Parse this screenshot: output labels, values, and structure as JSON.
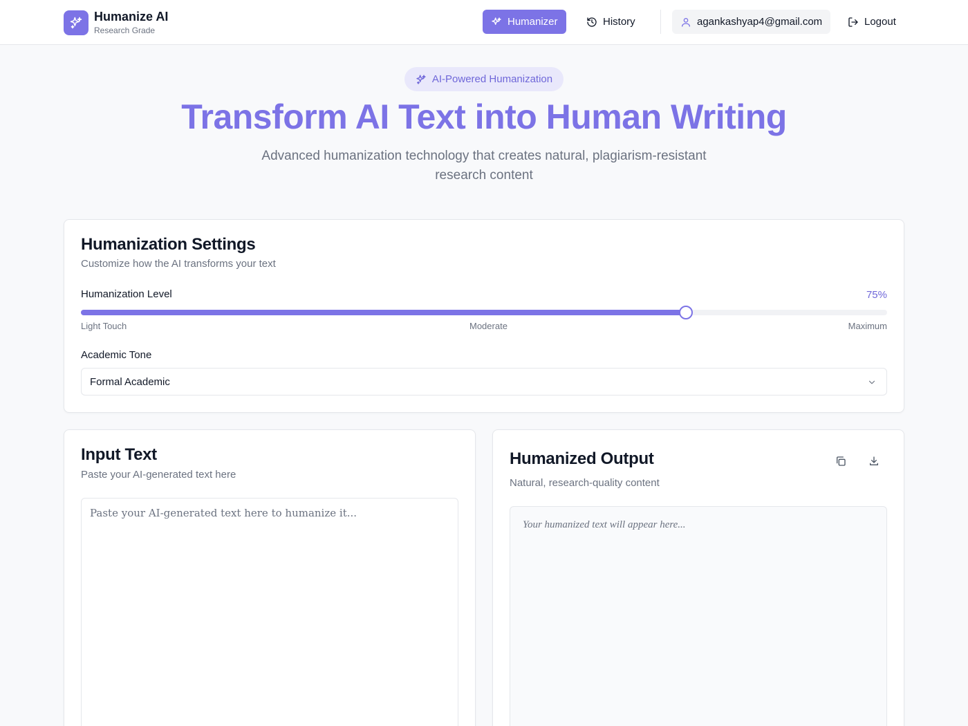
{
  "brand": {
    "name": "Humanize AI",
    "subtitle": "Research Grade",
    "icon": "sparkles-icon"
  },
  "nav": {
    "humanizer": "Humanizer",
    "history": "History",
    "user_email": "agankashyap4@gmail.com",
    "logout": "Logout"
  },
  "hero": {
    "badge": "AI-Powered Humanization",
    "title": "Transform AI Text into Human Writing",
    "subtitle": "Advanced humanization technology that creates natural, plagiarism-resistant research content"
  },
  "settings": {
    "title": "Humanization Settings",
    "description": "Customize how the AI transforms your text",
    "level_label": "Humanization Level",
    "level_value": 75,
    "level_display": "75%",
    "ticks": {
      "min": "Light Touch",
      "mid": "Moderate",
      "max": "Maximum"
    },
    "tone_label": "Academic Tone",
    "tone_selected": "Formal Academic"
  },
  "input": {
    "title": "Input Text",
    "description": "Paste your AI-generated text here",
    "placeholder": "Paste your AI-generated text here to humanize it...",
    "value": ""
  },
  "output": {
    "title": "Humanized Output",
    "description": "Natural, research-quality content",
    "placeholder": "Your humanized text will appear here..."
  },
  "colors": {
    "accent": "#7c73e6",
    "accent_soft": "#e9e8fb",
    "muted_text": "#6b7280",
    "border": "#e5e7eb"
  }
}
